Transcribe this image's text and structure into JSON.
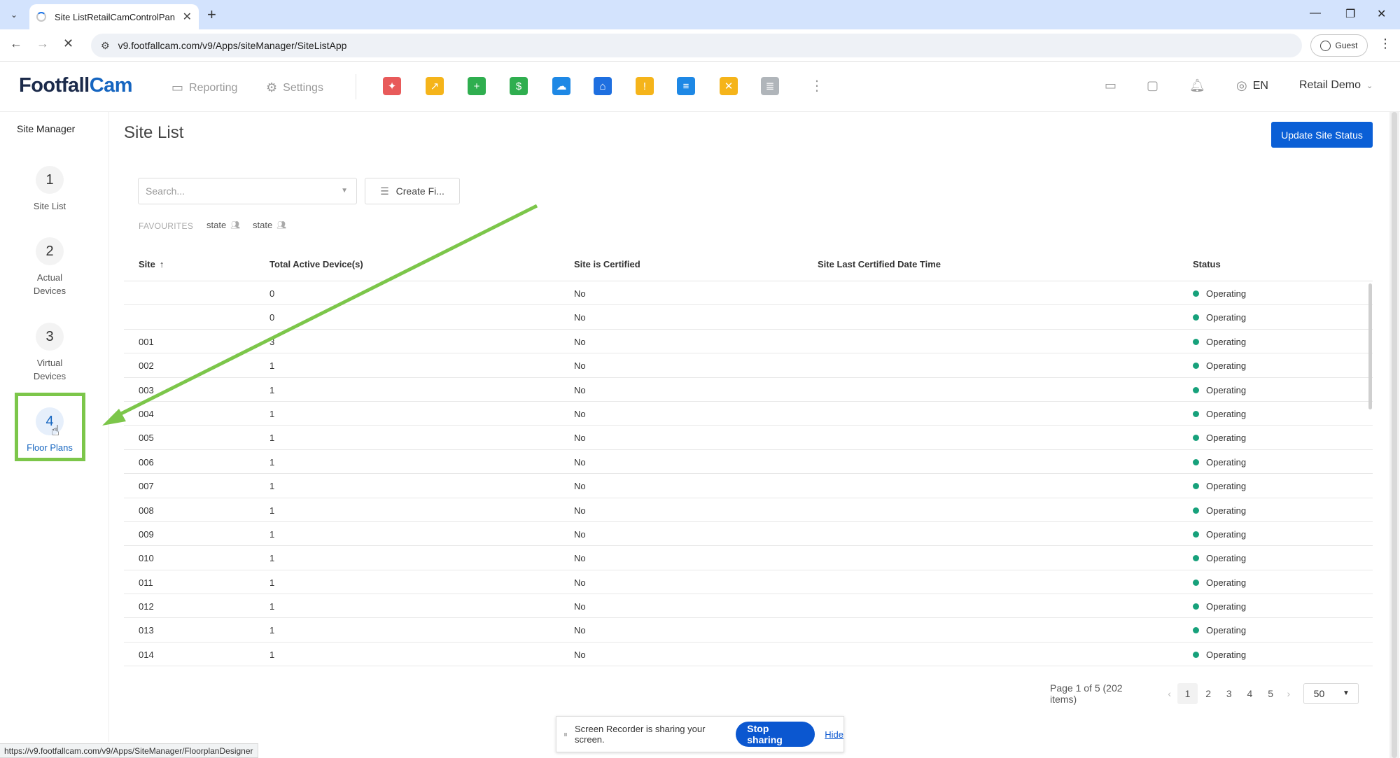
{
  "browser": {
    "tab_title": "Site ListRetailCamControlPanel",
    "url": "v9.footfallcam.com/v9/Apps/siteManager/SiteListApp",
    "profile": "Guest",
    "status_url": "https://v9.footfallcam.com/v9/Apps/SiteManager/FloorplanDesigner"
  },
  "header": {
    "logo_part1": "Footfall",
    "logo_part2": "Cam",
    "menu": [
      {
        "label": "Reporting",
        "icon": "calendar-icon"
      },
      {
        "label": "Settings",
        "icon": "gear-icon"
      }
    ],
    "apps": [
      {
        "icon": "gift-icon",
        "color": "#e85a5a"
      },
      {
        "icon": "chart-up-icon",
        "color": "#f5b41a"
      },
      {
        "icon": "calendar-add-icon",
        "color": "#2fae4f"
      },
      {
        "icon": "money-icon",
        "color": "#2fae4f"
      },
      {
        "icon": "weather-icon",
        "color": "#1e88e5"
      },
      {
        "icon": "home-icon",
        "color": "#1e6fe0"
      },
      {
        "icon": "alert-note-icon",
        "color": "#f5b41a"
      },
      {
        "icon": "database-icon",
        "color": "#1e88e5"
      },
      {
        "icon": "tools-icon",
        "color": "#f5b41a"
      },
      {
        "icon": "storage-icon",
        "color": "#9aa0a6"
      }
    ],
    "language": "EN",
    "user": "Retail Demo"
  },
  "sidebar": {
    "title": "Site Manager",
    "steps": [
      {
        "num": "1",
        "label": "Site List"
      },
      {
        "num": "2",
        "label": "Actual Devices"
      },
      {
        "num": "3",
        "label": "Virtual Devices"
      },
      {
        "num": "4",
        "label": "Floor Plans"
      }
    ]
  },
  "main": {
    "title": "Site List",
    "update_button": "Update Site Status",
    "search_placeholder": "Search...",
    "filter_button": "Create Fi...",
    "favourites_label": "FAVOURITES",
    "favourites": [
      "state",
      "state"
    ],
    "columns": [
      "Site",
      "Total Active Device(s)",
      "Site is Certified",
      "Site Last Certified Date Time",
      "Status"
    ],
    "rows": [
      {
        "site": "",
        "devices": "0",
        "certified": "No",
        "last": "",
        "status": "Operating"
      },
      {
        "site": "",
        "devices": "0",
        "certified": "No",
        "last": "",
        "status": "Operating"
      },
      {
        "site": "001",
        "devices": "3",
        "certified": "No",
        "last": "",
        "status": "Operating"
      },
      {
        "site": "002",
        "devices": "1",
        "certified": "No",
        "last": "",
        "status": "Operating"
      },
      {
        "site": "003",
        "devices": "1",
        "certified": "No",
        "last": "",
        "status": "Operating"
      },
      {
        "site": "004",
        "devices": "1",
        "certified": "No",
        "last": "",
        "status": "Operating"
      },
      {
        "site": "005",
        "devices": "1",
        "certified": "No",
        "last": "",
        "status": "Operating"
      },
      {
        "site": "006",
        "devices": "1",
        "certified": "No",
        "last": "",
        "status": "Operating"
      },
      {
        "site": "007",
        "devices": "1",
        "certified": "No",
        "last": "",
        "status": "Operating"
      },
      {
        "site": "008",
        "devices": "1",
        "certified": "No",
        "last": "",
        "status": "Operating"
      },
      {
        "site": "009",
        "devices": "1",
        "certified": "No",
        "last": "",
        "status": "Operating"
      },
      {
        "site": "010",
        "devices": "1",
        "certified": "No",
        "last": "",
        "status": "Operating"
      },
      {
        "site": "011",
        "devices": "1",
        "certified": "No",
        "last": "",
        "status": "Operating"
      },
      {
        "site": "012",
        "devices": "1",
        "certified": "No",
        "last": "",
        "status": "Operating"
      },
      {
        "site": "013",
        "devices": "1",
        "certified": "No",
        "last": "",
        "status": "Operating"
      },
      {
        "site": "014",
        "devices": "1",
        "certified": "No",
        "last": "",
        "status": "Operating"
      }
    ],
    "pagination": {
      "info": "Page 1 of 5 (202 items)",
      "pages": [
        "1",
        "2",
        "3",
        "4",
        "5"
      ],
      "current": "1",
      "page_size": "50"
    }
  },
  "screen_share": {
    "message": "Screen Recorder is sharing your screen.",
    "stop_label": "Stop sharing",
    "hide_label": "Hide"
  },
  "colors": {
    "primary": "#0a5fd6",
    "status_operating": "#17a17b",
    "highlight": "#7cc64a"
  }
}
